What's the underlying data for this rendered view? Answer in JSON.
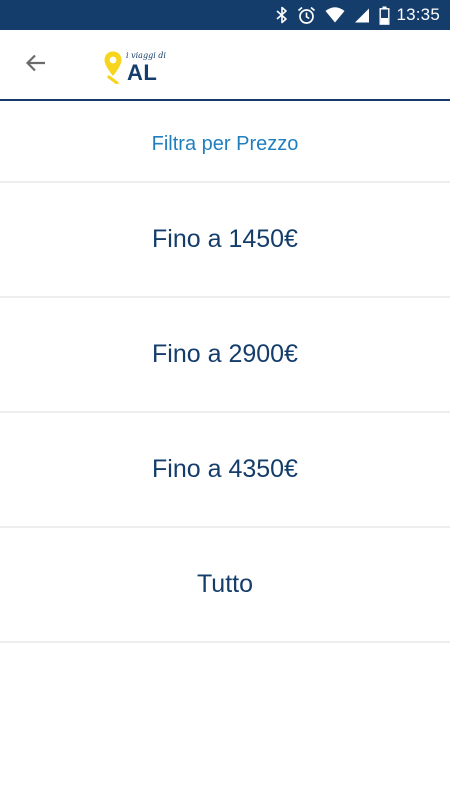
{
  "status_bar": {
    "time": "13:35",
    "icons": [
      "bluetooth-icon",
      "alarm-icon",
      "wifi-icon",
      "signal-icon",
      "battery-icon"
    ],
    "background_color": "#143d6b"
  },
  "app_bar": {
    "back_icon": "arrow-left-icon",
    "logo": {
      "tagline": "i viaggi di",
      "name": "AL",
      "pin_color": "#f7d51d",
      "text_color": "#143d6b"
    }
  },
  "filter": {
    "title": "Filtra per Prezzo",
    "title_color": "#1f7fbf",
    "options": [
      {
        "label": "Fino a 1450€"
      },
      {
        "label": "Fino a 2900€"
      },
      {
        "label": "Fino a 4350€"
      },
      {
        "label": "Tutto"
      }
    ],
    "option_color": "#143d6b"
  }
}
